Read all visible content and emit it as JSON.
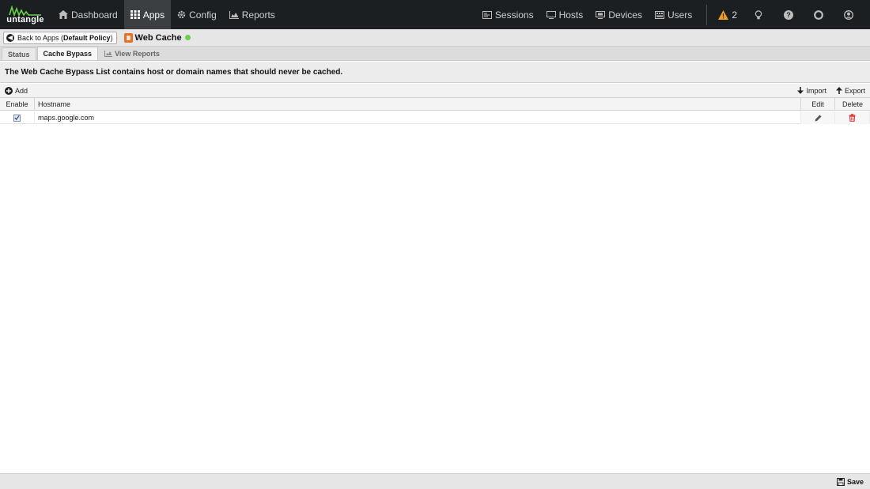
{
  "brand": {
    "name": "untangle"
  },
  "nav": {
    "left": [
      {
        "label": "Dashboard",
        "icon": "home-icon"
      },
      {
        "label": "Apps",
        "icon": "grid-icon",
        "active": true
      },
      {
        "label": "Config",
        "icon": "gear-icon"
      },
      {
        "label": "Reports",
        "icon": "area-chart-icon"
      }
    ],
    "right": [
      {
        "label": "Sessions",
        "icon": "sessions-icon"
      },
      {
        "label": "Hosts",
        "icon": "hosts-icon"
      },
      {
        "label": "Devices",
        "icon": "devices-icon"
      },
      {
        "label": "Users",
        "icon": "users-icon"
      }
    ],
    "alerts_count": "2"
  },
  "appbar": {
    "back_prefix": "Back to Apps (",
    "back_policy": "Default Policy",
    "back_suffix": ")",
    "app_title": "Web Cache",
    "status_color": "#6ad04a"
  },
  "tabs": [
    {
      "label": "Status"
    },
    {
      "label": "Cache Bypass",
      "active": true
    },
    {
      "label": "View Reports"
    }
  ],
  "description": "The Web Cache Bypass List contains host or domain names that should never be cached.",
  "toolbar": {
    "add": "Add",
    "import": "Import",
    "export": "Export"
  },
  "grid": {
    "columns": {
      "enable": "Enable",
      "hostname": "Hostname",
      "edit": "Edit",
      "delete": "Delete"
    },
    "rows": [
      {
        "enabled": true,
        "hostname": "maps.google.com"
      }
    ]
  },
  "footer": {
    "save": "Save"
  },
  "colors": {
    "topbar": "#1b1f22",
    "alert": "#f0a020",
    "delete": "#e03030"
  }
}
